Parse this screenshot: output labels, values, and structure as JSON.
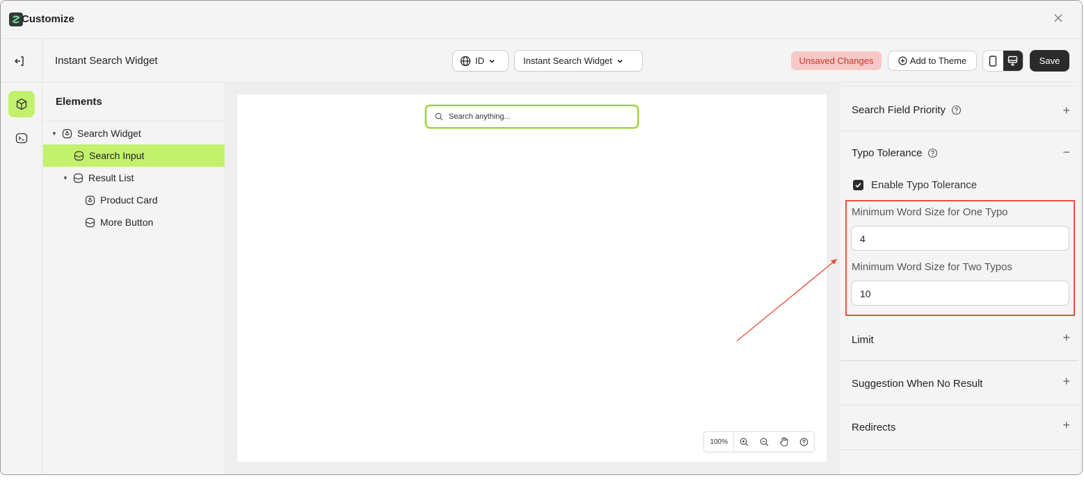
{
  "window": {
    "title": "Customize",
    "close_icon": "close-icon"
  },
  "toolbar": {
    "widget_name": "Instant Search Widget",
    "language": "ID",
    "widget_select": "Instant Search Widget",
    "unsaved_label": "Unsaved Changes",
    "add_to_theme_label": "Add to Theme",
    "save_label": "Save"
  },
  "elements_panel": {
    "heading": "Elements",
    "items": [
      {
        "label": "Search Widget",
        "icon": "widget-icon",
        "expanded": true
      },
      {
        "label": "Search Input",
        "icon": "block-icon",
        "selected": true
      },
      {
        "label": "Result List",
        "icon": "block-icon",
        "expanded": true
      },
      {
        "label": "Product Card",
        "icon": "widget-icon"
      },
      {
        "label": "More Button",
        "icon": "block-icon"
      }
    ]
  },
  "canvas": {
    "search_placeholder": "Search anything...",
    "zoom_level": "100%"
  },
  "settings": {
    "sections": [
      {
        "title": "Search Field Priority",
        "has_help": true,
        "expanded": false
      },
      {
        "title": "Typo Tolerance",
        "has_help": true,
        "expanded": true
      },
      {
        "title": "Limit",
        "has_help": false,
        "expanded": false
      },
      {
        "title": "Suggestion When No Result",
        "has_help": false,
        "expanded": false
      },
      {
        "title": "Redirects",
        "has_help": false,
        "expanded": false
      }
    ],
    "typo": {
      "enable_label": "Enable Typo Tolerance",
      "enabled": true,
      "min_one_label": "Minimum Word Size for One Typo",
      "min_one_value": "4",
      "min_two_label": "Minimum Word Size for Two Typos",
      "min_two_value": "10"
    },
    "toggle_plus": "+",
    "toggle_minus": "−"
  },
  "colors": {
    "accent": "#c2f16b",
    "save_bg": "#2b2b2b",
    "unsaved_bg": "#f6c9c6",
    "unsaved_text": "#c8322b",
    "annotation": "#e4533e"
  }
}
